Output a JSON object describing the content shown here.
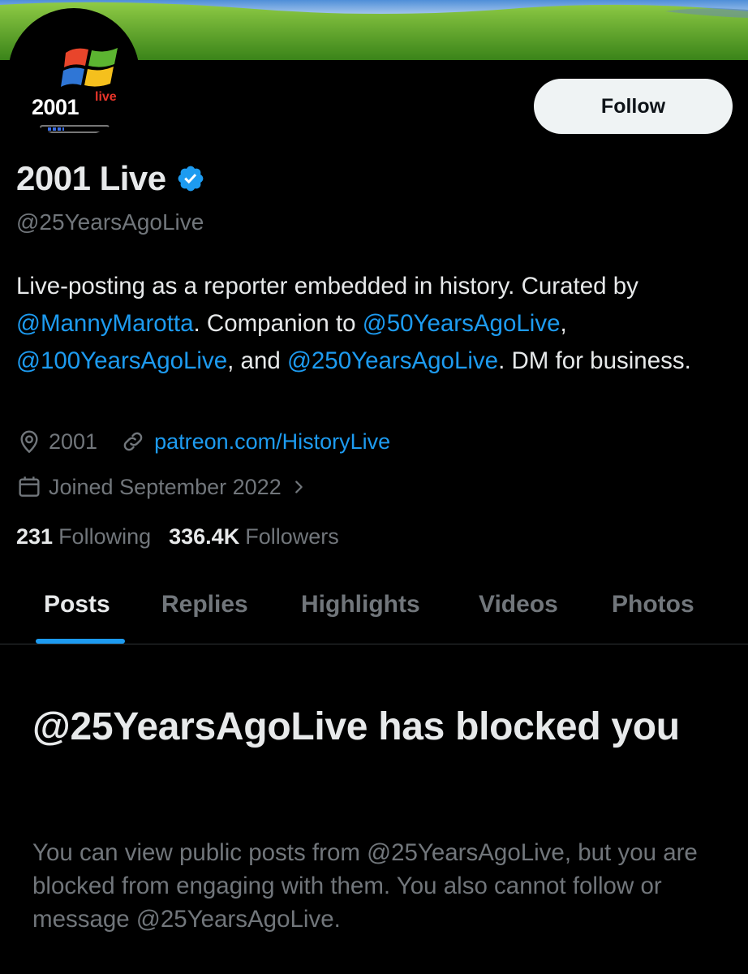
{
  "profile": {
    "avatar_text": "2001",
    "avatar_sup": "live",
    "follow_label": "Follow",
    "display_name": "2001 Live",
    "handle": "@25YearsAgoLive",
    "bio": {
      "part1": "Live-posting as a reporter embedded in history. Curated by ",
      "mention1": "@MannyMarotta",
      "part2": ". Companion to ",
      "mention2": "@50YearsAgoLive",
      "part3": ", ",
      "mention3": "@100YearsAgoLive",
      "part4": ", and ",
      "mention4": "@250YearsAgoLive",
      "part5": ". DM for business."
    },
    "location": "2001",
    "website": "patreon.com/HistoryLive",
    "joined": "Joined September 2022",
    "following_count": "231",
    "following_label": "Following",
    "followers_count": "336.4K",
    "followers_label": "Followers"
  },
  "tabs": [
    "Posts",
    "Replies",
    "Highlights",
    "Videos",
    "Photos"
  ],
  "active_tab": "Posts",
  "blocked": {
    "title": "@25YearsAgoLive has blocked you",
    "description": "You can view public posts from @25YearsAgoLive, but you are blocked from engaging with them. You also cannot follow or message @25YearsAgoLive."
  },
  "colors": {
    "accent": "#1d9bf0",
    "background": "#000000",
    "text_primary": "#e7e9ea",
    "text_secondary": "#71767b"
  }
}
